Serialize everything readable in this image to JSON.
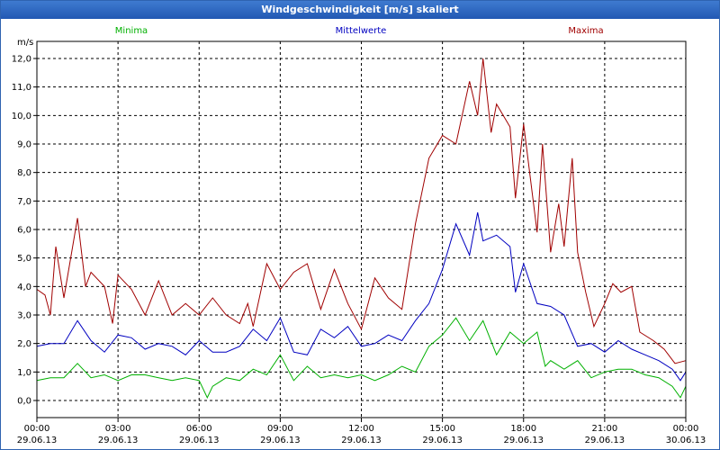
{
  "window": {
    "title": "Windgeschwindigkeit [m/s] skaliert"
  },
  "chart_data": {
    "type": "line",
    "title": "Windgeschwindigkeit [m/s] skaliert",
    "ylabel": "m/s",
    "ylim": [
      -0.6,
      12.6
    ],
    "yticks": [
      "0,0",
      "1,0",
      "2,0",
      "3,0",
      "4,0",
      "5,0",
      "6,0",
      "7,0",
      "8,0",
      "9,0",
      "10,0",
      "11,0",
      "12,0"
    ],
    "ytick_values": [
      0,
      1,
      2,
      3,
      4,
      5,
      6,
      7,
      8,
      9,
      10,
      11,
      12
    ],
    "xlim": [
      0,
      24
    ],
    "xticks": [
      {
        "time": "00:00",
        "date": "29.06.13"
      },
      {
        "time": "03:00",
        "date": "29.06.13"
      },
      {
        "time": "06:00",
        "date": "29.06.13"
      },
      {
        "time": "09:00",
        "date": "29.06.13"
      },
      {
        "time": "12:00",
        "date": "29.06.13"
      },
      {
        "time": "15:00",
        "date": "29.06.13"
      },
      {
        "time": "18:00",
        "date": "29.06.13"
      },
      {
        "time": "21:00",
        "date": "29.06.13"
      },
      {
        "time": "00:00",
        "date": "30.06.13"
      }
    ],
    "grid": true,
    "legend": "top",
    "series": [
      {
        "name": "Minima",
        "color": "#00b000",
        "points": [
          [
            0,
            0.7
          ],
          [
            0.5,
            0.8
          ],
          [
            1,
            0.8
          ],
          [
            1.5,
            1.3
          ],
          [
            2,
            0.8
          ],
          [
            2.5,
            0.9
          ],
          [
            3,
            0.7
          ],
          [
            3.5,
            0.9
          ],
          [
            4,
            0.9
          ],
          [
            4.5,
            0.8
          ],
          [
            5,
            0.7
          ],
          [
            5.5,
            0.8
          ],
          [
            6,
            0.7
          ],
          [
            6.3,
            0.1
          ],
          [
            6.5,
            0.5
          ],
          [
            7,
            0.8
          ],
          [
            7.5,
            0.7
          ],
          [
            8,
            1.1
          ],
          [
            8.5,
            0.9
          ],
          [
            9,
            1.6
          ],
          [
            9.5,
            0.7
          ],
          [
            10,
            1.2
          ],
          [
            10.5,
            0.8
          ],
          [
            11,
            0.9
          ],
          [
            11.5,
            0.8
          ],
          [
            12,
            0.9
          ],
          [
            12.5,
            0.7
          ],
          [
            13,
            0.9
          ],
          [
            13.5,
            1.2
          ],
          [
            14,
            1.0
          ],
          [
            14.5,
            1.9
          ],
          [
            15,
            2.3
          ],
          [
            15.5,
            2.9
          ],
          [
            16,
            2.1
          ],
          [
            16.5,
            2.8
          ],
          [
            17,
            1.6
          ],
          [
            17.5,
            2.4
          ],
          [
            18,
            2.0
          ],
          [
            18.5,
            2.4
          ],
          [
            18.8,
            1.2
          ],
          [
            19,
            1.4
          ],
          [
            19.5,
            1.1
          ],
          [
            20,
            1.4
          ],
          [
            20.5,
            0.8
          ],
          [
            21,
            1.0
          ],
          [
            21.5,
            1.1
          ],
          [
            22,
            1.1
          ],
          [
            22.5,
            0.9
          ],
          [
            23,
            0.8
          ],
          [
            23.5,
            0.5
          ],
          [
            23.8,
            0.1
          ],
          [
            24,
            0.5
          ]
        ]
      },
      {
        "name": "Mittelwerte",
        "color": "#0000c0",
        "points": [
          [
            0,
            1.9
          ],
          [
            0.5,
            2.0
          ],
          [
            1,
            2.0
          ],
          [
            1.5,
            2.8
          ],
          [
            2,
            2.1
          ],
          [
            2.5,
            1.7
          ],
          [
            3,
            2.3
          ],
          [
            3.5,
            2.2
          ],
          [
            4,
            1.8
          ],
          [
            4.5,
            2.0
          ],
          [
            5,
            1.9
          ],
          [
            5.5,
            1.6
          ],
          [
            6,
            2.1
          ],
          [
            6.5,
            1.7
          ],
          [
            7,
            1.7
          ],
          [
            7.5,
            1.9
          ],
          [
            8,
            2.5
          ],
          [
            8.5,
            2.1
          ],
          [
            9,
            2.9
          ],
          [
            9.5,
            1.7
          ],
          [
            10,
            1.6
          ],
          [
            10.5,
            2.5
          ],
          [
            11,
            2.2
          ],
          [
            11.5,
            2.6
          ],
          [
            12,
            1.9
          ],
          [
            12.5,
            2.0
          ],
          [
            13,
            2.3
          ],
          [
            13.5,
            2.1
          ],
          [
            14,
            2.8
          ],
          [
            14.5,
            3.4
          ],
          [
            15,
            4.6
          ],
          [
            15.5,
            6.2
          ],
          [
            16,
            5.1
          ],
          [
            16.3,
            6.6
          ],
          [
            16.5,
            5.6
          ],
          [
            17,
            5.8
          ],
          [
            17.5,
            5.4
          ],
          [
            17.7,
            3.8
          ],
          [
            18,
            4.8
          ],
          [
            18.5,
            3.4
          ],
          [
            19,
            3.3
          ],
          [
            19.5,
            3.0
          ],
          [
            20,
            1.9
          ],
          [
            20.5,
            2.0
          ],
          [
            21,
            1.7
          ],
          [
            21.5,
            2.1
          ],
          [
            22,
            1.8
          ],
          [
            22.5,
            1.6
          ],
          [
            23,
            1.4
          ],
          [
            23.5,
            1.1
          ],
          [
            23.8,
            0.7
          ],
          [
            24,
            1.0
          ]
        ]
      },
      {
        "name": "Maxima",
        "color": "#a00000",
        "points": [
          [
            0,
            3.9
          ],
          [
            0.3,
            3.7
          ],
          [
            0.5,
            3.0
          ],
          [
            0.7,
            5.4
          ],
          [
            1,
            3.6
          ],
          [
            1.5,
            6.4
          ],
          [
            1.8,
            4.0
          ],
          [
            2,
            4.5
          ],
          [
            2.5,
            4.0
          ],
          [
            2.8,
            2.7
          ],
          [
            3,
            4.4
          ],
          [
            3.5,
            3.9
          ],
          [
            4,
            3.0
          ],
          [
            4.5,
            4.2
          ],
          [
            5,
            3.0
          ],
          [
            5.5,
            3.4
          ],
          [
            6,
            3.0
          ],
          [
            6.5,
            3.6
          ],
          [
            7,
            3.0
          ],
          [
            7.5,
            2.7
          ],
          [
            7.8,
            3.4
          ],
          [
            8,
            2.6
          ],
          [
            8.5,
            4.8
          ],
          [
            9,
            3.9
          ],
          [
            9.5,
            4.5
          ],
          [
            10,
            4.8
          ],
          [
            10.5,
            3.2
          ],
          [
            11,
            4.6
          ],
          [
            11.5,
            3.4
          ],
          [
            12,
            2.5
          ],
          [
            12.5,
            4.3
          ],
          [
            13,
            3.6
          ],
          [
            13.5,
            3.2
          ],
          [
            14,
            6.2
          ],
          [
            14.5,
            8.5
          ],
          [
            15,
            9.3
          ],
          [
            15.5,
            9.0
          ],
          [
            16,
            11.2
          ],
          [
            16.3,
            10.0
          ],
          [
            16.5,
            12.0
          ],
          [
            16.8,
            9.4
          ],
          [
            17,
            10.4
          ],
          [
            17.5,
            9.6
          ],
          [
            17.7,
            7.1
          ],
          [
            18,
            9.7
          ],
          [
            18.5,
            5.9
          ],
          [
            18.7,
            9.0
          ],
          [
            19,
            5.2
          ],
          [
            19.3,
            6.9
          ],
          [
            19.5,
            5.4
          ],
          [
            19.8,
            8.5
          ],
          [
            20,
            5.2
          ],
          [
            20.3,
            3.8
          ],
          [
            20.6,
            2.6
          ],
          [
            21,
            3.4
          ],
          [
            21.3,
            4.1
          ],
          [
            21.6,
            3.8
          ],
          [
            22,
            4.0
          ],
          [
            22.3,
            2.4
          ],
          [
            22.8,
            2.1
          ],
          [
            23.2,
            1.8
          ],
          [
            23.6,
            1.3
          ],
          [
            24,
            1.4
          ]
        ]
      }
    ]
  }
}
